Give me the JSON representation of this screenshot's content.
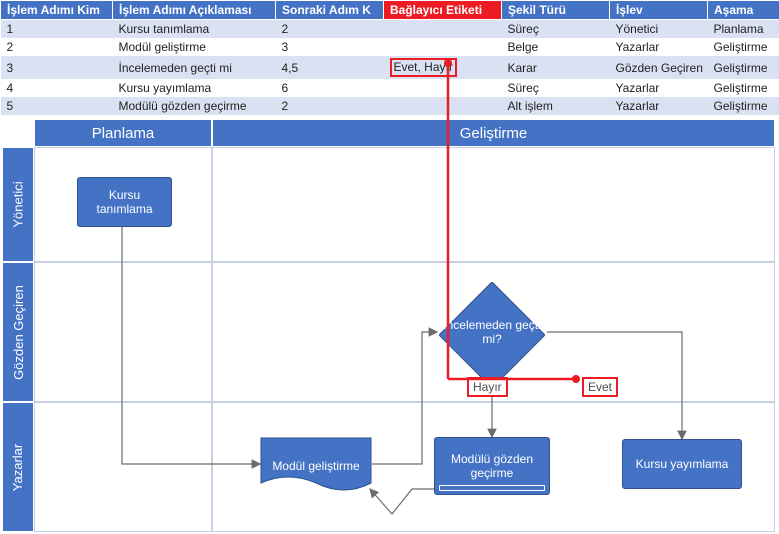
{
  "table": {
    "headers": {
      "step_id": "İşlem Adımı Kim",
      "step_desc": "İşlem Adımı Açıklaması",
      "next_step": "Sonraki Adım K",
      "connector_label": "Bağlayıcı Etiketi",
      "shape_type": "Şekil Türü",
      "function": "İşlev",
      "phase": "Aşama"
    },
    "rows": [
      {
        "id": "1",
        "desc": "Kursu tanımlama",
        "next": "2",
        "conn": "",
        "shape": "Süreç",
        "func": "Yönetici",
        "phase": "Planlama"
      },
      {
        "id": "2",
        "desc": "Modül geliştirme",
        "next": "3",
        "conn": "",
        "shape": "Belge",
        "func": "Yazarlar",
        "phase": "Geliştirme"
      },
      {
        "id": "3",
        "desc": "İncelemeden geçti mi",
        "next": "4,5",
        "conn": "Evet, Hayır",
        "shape": "Karar",
        "func": "Gözden Geçiren",
        "phase": "Geliştirme"
      },
      {
        "id": "4",
        "desc": "Kursu yayımlama",
        "next": "6",
        "conn": "",
        "shape": "Süreç",
        "func": "Yazarlar",
        "phase": "Geliştirme"
      },
      {
        "id": "5",
        "desc": "Modülü gözden geçirme",
        "next": "2",
        "conn": "",
        "shape": "Alt işlem",
        "func": "Yazarlar",
        "phase": "Geliştirme"
      }
    ]
  },
  "swimlane": {
    "phases": {
      "planlama": "Planlama",
      "gelistirme": "Geliştirme"
    },
    "lanes": {
      "yonetici": "Yönetici",
      "gozden": "Gözden Geçiren",
      "yazarlar": "Yazarlar"
    },
    "shapes": {
      "kursu_tanimla": "Kursu tanımlama",
      "modul_gelistir": "Modül geliştirme",
      "inceleme": "İncelemeden geçti mi?",
      "modul_gozden": "Modülü gözden geçirme",
      "kursu_yayim": "Kursu yayımlama"
    },
    "labels": {
      "hayir": "Hayır",
      "evet": "Evet"
    }
  },
  "colors": {
    "primary": "#4472C4",
    "accent": "#ED1C24"
  }
}
